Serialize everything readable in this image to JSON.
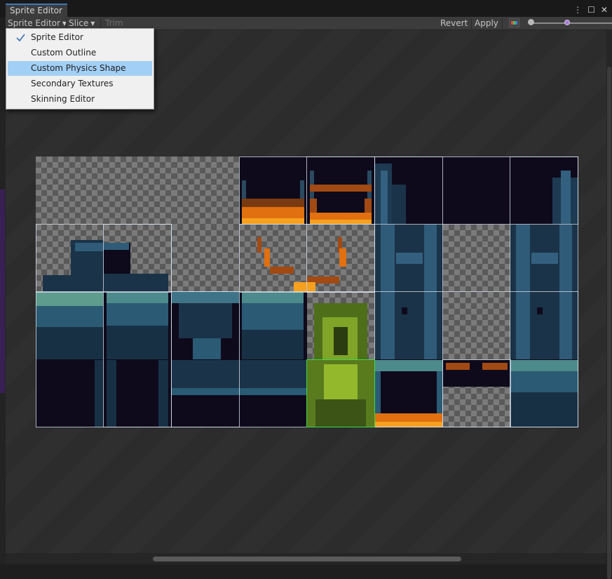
{
  "window": {
    "tab_label": "Sprite Editor",
    "kebab_icon": "⋮",
    "maximize_icon": "☐",
    "close_icon": "✕"
  },
  "toolbar": {
    "mode_dropdown": "Sprite Editor",
    "slice_dropdown": "Slice",
    "trim_label": "Trim",
    "revert_label": "Revert",
    "apply_label": "Apply"
  },
  "menu": {
    "items": [
      {
        "label": "Sprite Editor",
        "checked": true,
        "highlighted": false
      },
      {
        "label": "Custom Outline",
        "checked": false,
        "highlighted": false
      },
      {
        "label": "Custom Physics Shape",
        "checked": false,
        "highlighted": true
      },
      {
        "label": "Secondary Textures",
        "checked": false,
        "highlighted": false
      },
      {
        "label": "Skinning Editor",
        "checked": false,
        "highlighted": false
      }
    ]
  },
  "colors": {
    "accent": "#3a79bb",
    "menu_highlight": "#a2cff5",
    "selected_sprite_outline": "#38d84a",
    "sprite_frame_outline": "#dce6f0"
  }
}
